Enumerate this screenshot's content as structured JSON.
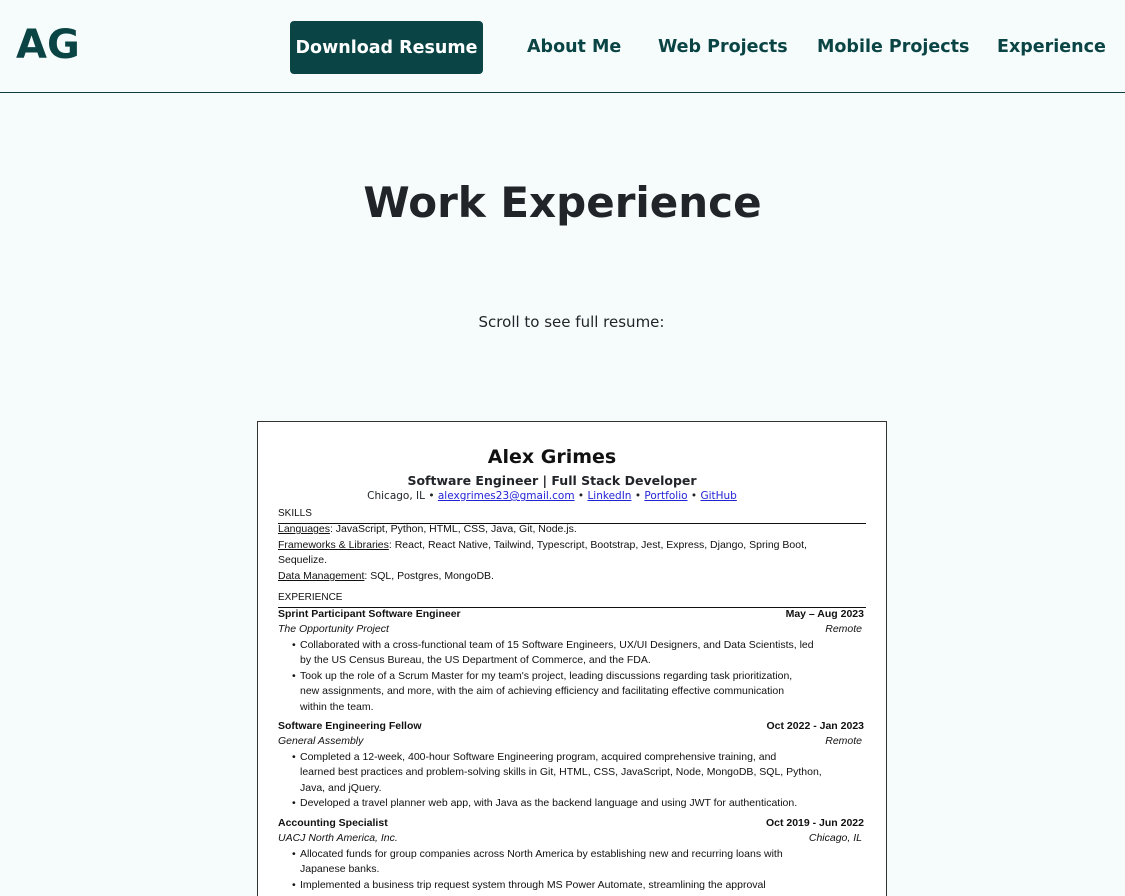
{
  "nav": {
    "logo": "AG",
    "download_label": "Download Resume",
    "links": [
      "About Me",
      "Web Projects",
      "Mobile Projects",
      "Experience"
    ]
  },
  "main": {
    "title": "Work Experience",
    "scroll_note": "Scroll to see full resume:"
  },
  "resume": {
    "name": "Alex Grimes",
    "role": "Software Engineer | Full Stack Developer",
    "contact": {
      "location": "Chicago, IL",
      "sep": "•",
      "email": "alexgrimes23@gmail.com",
      "linkedin": "LinkedIn",
      "portfolio": "Portfolio",
      "github": "GitHub"
    },
    "skills_heading": "SKILLS",
    "skills": [
      {
        "label": "Languages",
        "value": ": JavaScript, Python, HTML, CSS, Java, Git, Node.js."
      },
      {
        "label": "Frameworks & Libraries",
        "value": ": React, React Native, Tailwind, Typescript, Bootstrap, Jest, Express, Django, Spring Boot,"
      },
      {
        "label": "",
        "value": "Sequelize."
      },
      {
        "label": "Data Management",
        "value": ": SQL, Postgres, MongoDB."
      }
    ],
    "experience_heading": "EXPERIENCE",
    "jobs": [
      {
        "title": "Sprint Participant Software Engineer",
        "date": "May – Aug 2023",
        "org": "The Opportunity Project",
        "location": "Remote",
        "bullets": [
          "Collaborated with a cross-functional team of 15 Software Engineers, UX/UI Designers, and Data Scientists, led",
          "by the US Census Bureau, the US Department of Commerce, and the FDA.",
          "Took up the role of a Scrum Master for my team's project, leading discussions regarding task prioritization,",
          "new assignments, and more, with the aim of achieving efficiency and facilitating effective communication",
          "within the team."
        ]
      },
      {
        "title": "Software Engineering Fellow",
        "date": "Oct 2022 - Jan 2023",
        "org": "General Assembly",
        "location": "Remote",
        "bullets": [
          "Completed a 12-week, 400-hour Software Engineering program, acquired comprehensive training, and",
          "learned best practices and problem-solving skills in Git, HTML, CSS, JavaScript, Node, MongoDB, SQL, Python,",
          "Java, and jQuery.",
          "Developed a travel planner web app, with Java as the backend language and using JWT for authentication."
        ]
      },
      {
        "title": "Accounting Specialist",
        "date": "Oct 2019 - Jun 2022",
        "org": "UACJ North America, Inc.",
        "location": "Chicago, IL",
        "bullets": [
          "Allocated funds for group companies across North America by establishing new and recurring loans with",
          "Japanese banks.",
          "Implemented a business trip request system through MS Power Automate, streamlining the approval"
        ]
      }
    ]
  }
}
